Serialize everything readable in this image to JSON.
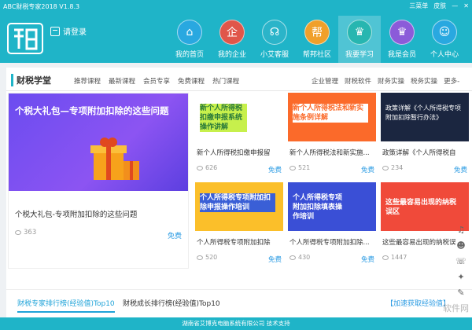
{
  "titlebar": {
    "app_title": "ABC财税专家2018 V1.8.3",
    "menu": "三菜单",
    "skin": "皮肤",
    "minimize": "—",
    "close": "✕"
  },
  "header": {
    "login": "请登录"
  },
  "nav": [
    {
      "label": "我的首页",
      "icon": "home-icon",
      "glyph": "⌂",
      "color": "#29a8e0"
    },
    {
      "label": "我的企业",
      "icon": "company-icon",
      "glyph": "企",
      "color": "#e0564a"
    },
    {
      "label": "小艾客服",
      "icon": "headset-icon",
      "glyph": "☊",
      "color": "#2bb4c9"
    },
    {
      "label": "帮邦社区",
      "icon": "community-icon",
      "glyph": "帮",
      "color": "#f0a02a"
    },
    {
      "label": "我要学习",
      "icon": "graduation-icon",
      "glyph": "♛",
      "color": "#27b6b0"
    },
    {
      "label": "我是会员",
      "icon": "crown-icon",
      "glyph": "♛",
      "color": "#8b5bd9"
    },
    {
      "label": "个人中心",
      "icon": "user-icon",
      "glyph": "☺",
      "color": "#29a8e0"
    }
  ],
  "category": {
    "title": "财税学堂",
    "links": [
      "推荐课程",
      "最新课程",
      "会员专享",
      "免费课程",
      "热门课程"
    ],
    "links2": [
      "企业管理",
      "财税软件",
      "财务实操",
      "税务实操",
      "更多-"
    ]
  },
  "feature": {
    "banner_text": "个税大礼包—专项附加扣除的这些问题",
    "title": "个税大礼包-专项附加扣除的这些问题",
    "views": "363",
    "price": "免费"
  },
  "cards": [
    {
      "img_text": "新个人所得税扣缴申报系统操作讲解",
      "title": "新个人所得税扣缴申报留",
      "views": "626",
      "price": "免费"
    },
    {
      "img_text": "新个人所得税法和新实施条例详解",
      "title": "新个人所得税法和新实施...",
      "views": "521",
      "price": "免费"
    },
    {
      "img_text": "政策详解《个人所得税专项附加扣除暂行办法》",
      "title": "政策详解《个人所得税自",
      "views": "234",
      "price": "免费"
    },
    {
      "img_text": "个人所得税专项附加扣除申报操作培训",
      "title": "个人所得税专项附加扣除",
      "views": "520",
      "price": "免费"
    },
    {
      "img_text": "个人所得税专项附加扣除填表操作培训",
      "title": "个人所得税专项附加扣除...",
      "views": "430",
      "price": "免费"
    },
    {
      "img_text": "这些最容易出现的纳税误区",
      "title": "这些最容易出现的纳税误",
      "views": "1447",
      "price": ""
    }
  ],
  "tabs": {
    "tab1": "财税专家排行榜(经验值)Top10",
    "tab2": "财税成长排行榜(经验值)Top10",
    "link": "【加速获取经验值】"
  },
  "footer": "湖南省艾博克电脑系统有限公司 技术支持",
  "watermark": "软件网"
}
